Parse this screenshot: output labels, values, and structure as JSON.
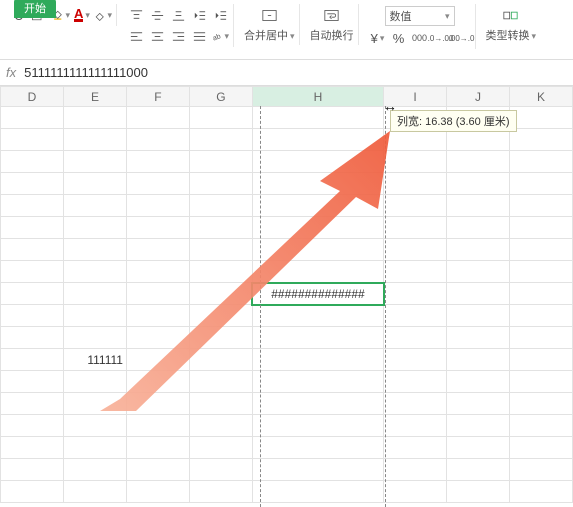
{
  "ribbon": {
    "tab_active": "开始",
    "merge_label": "合并居中",
    "wrap_label": "自动换行",
    "numfmt_label": "数值",
    "typeconv_label": "类型转换"
  },
  "formula_bar": {
    "fx": "fx",
    "value": "5111111111111111000"
  },
  "columns": [
    "D",
    "E",
    "F",
    "G",
    "H",
    "I",
    "J",
    "K"
  ],
  "tooltip": "列宽: 16.38 (3.60 厘米)",
  "cells": {
    "H_hash": "##############",
    "E_111111": "111111"
  }
}
